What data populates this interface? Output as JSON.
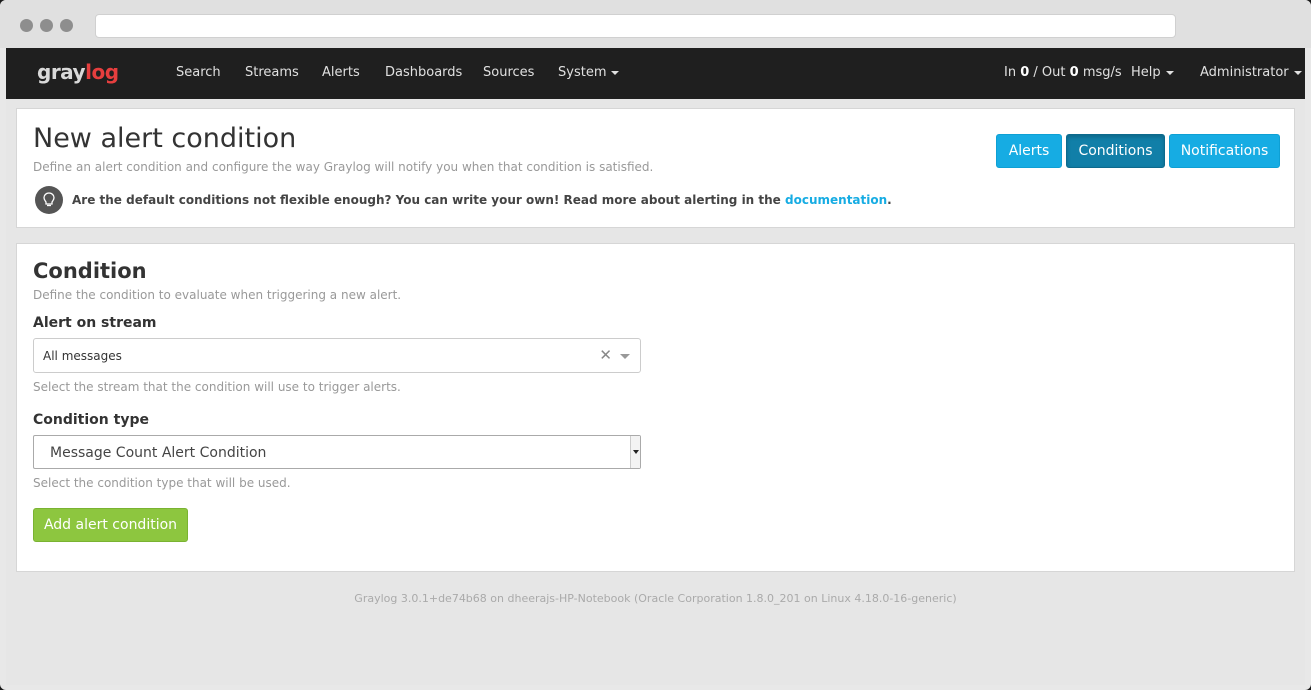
{
  "navbar": {
    "brand_gray": "gray",
    "brand_red": "log",
    "items": [
      {
        "label": "Search"
      },
      {
        "label": "Streams"
      },
      {
        "label": "Alerts"
      },
      {
        "label": "Dashboards"
      },
      {
        "label": "Sources"
      },
      {
        "label": "System"
      }
    ],
    "throughput": {
      "in_label": "In",
      "in_value": "0",
      "sep": "/ Out",
      "out_value": "0",
      "unit": "msg/s"
    },
    "help": "Help",
    "user": "Administrator"
  },
  "header": {
    "title": "New alert condition",
    "description": "Define an alert condition and configure the way Graylog will notify you when that condition is satisfied.",
    "tip_text": "Are the default conditions not flexible enough? You can write your own! Read more about alerting in the",
    "tip_link": "documentation",
    "tip_end": ".",
    "buttons": {
      "alerts": "Alerts",
      "conditions": "Conditions",
      "notifications": "Notifications"
    }
  },
  "condition": {
    "title": "Condition",
    "description": "Define the condition to evaluate when triggering a new alert.",
    "stream_label": "Alert on stream",
    "stream_value": "All messages",
    "stream_help": "Select the stream that the condition will use to trigger alerts.",
    "type_label": "Condition type",
    "type_value": "Message Count Alert Condition",
    "type_help": "Select the condition type that will be used.",
    "submit": "Add alert condition"
  },
  "footer": {
    "text": "Graylog 3.0.1+de74b68 on dheerajs-HP-Notebook (Oracle Corporation 1.8.0_201 on Linux 4.18.0-16-generic)"
  },
  "colors": {
    "accent": "#16ace3",
    "active": "#117fa8",
    "success": "#8dc63f",
    "navbar": "#1f1f1f",
    "brand_red": "#e63e3e"
  }
}
